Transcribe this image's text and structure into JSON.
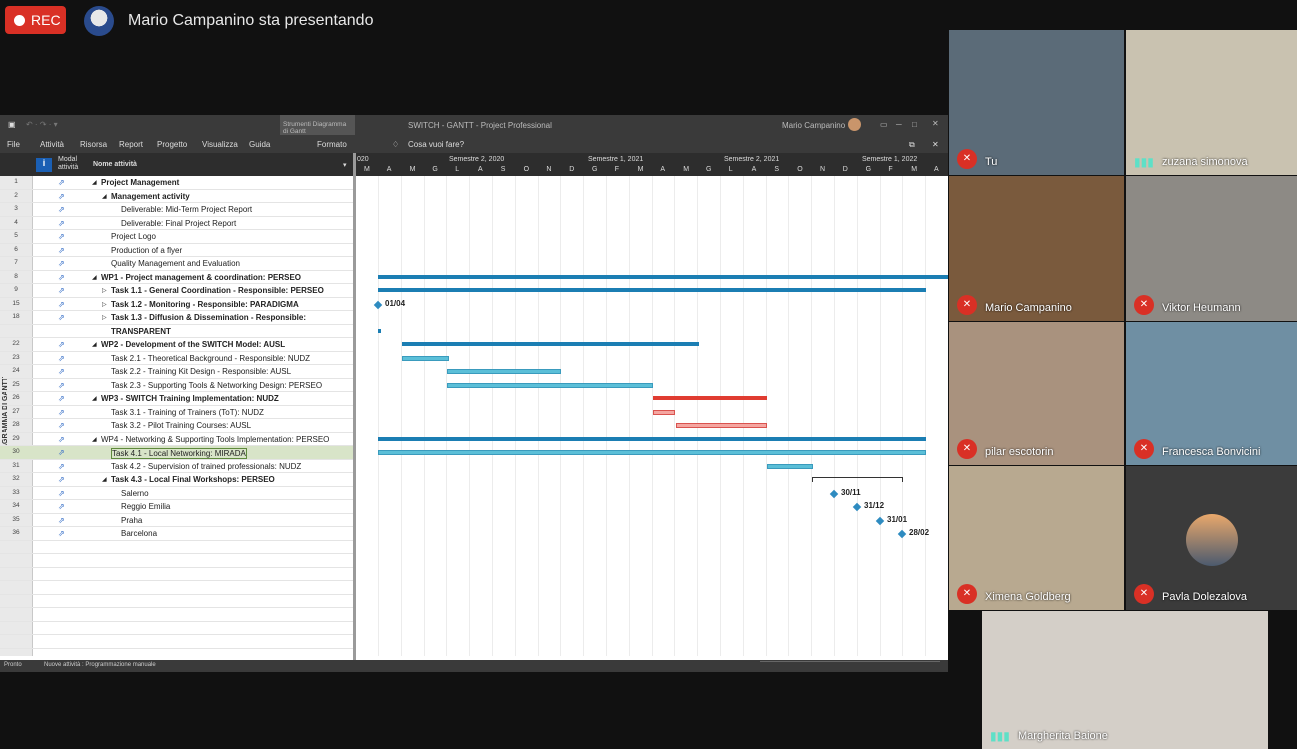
{
  "meeting": {
    "rec_label": "REC",
    "presenter_label": "Mario Campanino sta presentando"
  },
  "project_window": {
    "title_tools": "Strumenti Diagramma di Gantt",
    "title": "SWITCH - GANTT - Project Professional",
    "user": "Mario Campanino",
    "menu": [
      "File",
      "Attività",
      "Risorsa",
      "Report",
      "Progetto",
      "Visualizza",
      "Guida",
      "Formato"
    ],
    "tell_me": "Cosa vuoi fare?",
    "grid_headers": {
      "mode": "Modal attività",
      "name": "Nome attività"
    },
    "side_tab": "DIAGRAMMA DI GANTT",
    "timeline": {
      "semesters": [
        "Semestre 2, 2020",
        "Semestre 1, 2021",
        "Semestre 2, 2021",
        "Semestre 1, 2022"
      ],
      "year_stub": "020",
      "months": [
        "M",
        "A",
        "M",
        "G",
        "L",
        "A",
        "S",
        "O",
        "N",
        "D",
        "G",
        "F",
        "M",
        "A",
        "M",
        "G",
        "L",
        "A",
        "S",
        "O",
        "N",
        "D",
        "G",
        "F",
        "M",
        "A"
      ]
    },
    "rows": [
      {
        "id": "1",
        "name": "Project Management",
        "indent": 0,
        "bold": true,
        "prefix": "◢"
      },
      {
        "id": "2",
        "name": "Management activity",
        "indent": 1,
        "bold": true,
        "prefix": "◢"
      },
      {
        "id": "3",
        "name": "Deliverable: Mid-Term Project Report",
        "indent": 2,
        "bold": false,
        "prefix": ""
      },
      {
        "id": "4",
        "name": "Deliverable: Final Project Report",
        "indent": 2,
        "bold": false,
        "prefix": ""
      },
      {
        "id": "5",
        "name": "Project Logo",
        "indent": 1,
        "bold": false,
        "prefix": ""
      },
      {
        "id": "6",
        "name": "Production of a flyer",
        "indent": 1,
        "bold": false,
        "prefix": ""
      },
      {
        "id": "7",
        "name": "Quality Management and Evaluation",
        "indent": 1,
        "bold": false,
        "prefix": ""
      },
      {
        "id": "8",
        "name": "WP1 - Project management & coordination: PERSEO",
        "indent": 0,
        "bold": true,
        "prefix": "◢"
      },
      {
        "id": "9",
        "name": "Task 1.1 - General Coordination - Responsible: PERSEO",
        "indent": 1,
        "bold": true,
        "prefix": "▷"
      },
      {
        "id": "15",
        "name": "Task 1.2 - Monitoring - Responsible: PARADIGMA",
        "indent": 1,
        "bold": true,
        "prefix": "▷"
      },
      {
        "id": "18",
        "name": "Task 1.3 - Diffusion & Dissemination - Responsible:",
        "indent": 1,
        "bold": true,
        "prefix": "▷"
      },
      {
        "id": "",
        "name": "TRANSPARENT",
        "indent": 1,
        "bold": true,
        "prefix": ""
      },
      {
        "id": "22",
        "name": "WP2 - Development of the SWITCH Model: AUSL",
        "indent": 0,
        "bold": true,
        "prefix": "◢"
      },
      {
        "id": "23",
        "name": "Task 2.1 - Theoretical Background - Responsible: NUDZ",
        "indent": 1,
        "bold": false,
        "prefix": ""
      },
      {
        "id": "24",
        "name": "Task 2.2 - Training Kit Design - Responsible: AUSL",
        "indent": 1,
        "bold": false,
        "prefix": ""
      },
      {
        "id": "25",
        "name": "Task 2.3 - Supporting Tools & Networking Design: PERSEO",
        "indent": 1,
        "bold": false,
        "prefix": ""
      },
      {
        "id": "26",
        "name": "WP3 - SWITCH Training Implementation: NUDZ",
        "indent": 0,
        "bold": true,
        "prefix": "◢"
      },
      {
        "id": "27",
        "name": "Task 3.1 - Training of Trainers (ToT): NUDZ",
        "indent": 1,
        "bold": false,
        "prefix": ""
      },
      {
        "id": "28",
        "name": "Task 3.2 - Pilot Training Courses: AUSL",
        "indent": 1,
        "bold": false,
        "prefix": ""
      },
      {
        "id": "29",
        "name": "WP4 - Networking & Supporting Tools Implementation: PERSEO",
        "indent": 0,
        "bold": false,
        "prefix": "◢"
      },
      {
        "id": "30",
        "name": "Task 4.1 - Local Networking: MIRADA",
        "indent": 1,
        "bold": false,
        "prefix": "",
        "selected": true
      },
      {
        "id": "31",
        "name": "Task 4.2 - Supervision of trained professionals: NUDZ",
        "indent": 1,
        "bold": false,
        "prefix": ""
      },
      {
        "id": "32",
        "name": "Task 4.3 - Local Final Workshops: PERSEO",
        "indent": 1,
        "bold": true,
        "prefix": "◢"
      },
      {
        "id": "33",
        "name": "Salerno",
        "indent": 2,
        "bold": false,
        "prefix": ""
      },
      {
        "id": "34",
        "name": "Reggio Emilia",
        "indent": 2,
        "bold": false,
        "prefix": ""
      },
      {
        "id": "35",
        "name": "Praha",
        "indent": 2,
        "bold": false,
        "prefix": ""
      },
      {
        "id": "36",
        "name": "Barcelona",
        "indent": 2,
        "bold": false,
        "prefix": ""
      }
    ],
    "milestones": [
      "01/04",
      "30/11",
      "31/12",
      "31/01",
      "28/02"
    ],
    "status": [
      "Pronto",
      "Nuove attività : Programmazione manuale"
    ]
  },
  "participants": [
    {
      "name": "Tu",
      "state": "muted"
    },
    {
      "name": "zuzana simonova",
      "state": "talking"
    },
    {
      "name": "Mario Campanino",
      "state": "muted"
    },
    {
      "name": "Viktor Heumann",
      "state": "muted"
    },
    {
      "name": "pilar escotorin",
      "state": "muted"
    },
    {
      "name": "Francesca Bonvicini",
      "state": "muted"
    },
    {
      "name": "Ximena Goldberg",
      "state": "muted"
    },
    {
      "name": "Pavla Dolezalova",
      "state": "muted"
    },
    {
      "name": "Margherita Baione",
      "state": "talking"
    }
  ],
  "colors": {
    "rec": "#d93025",
    "summary_bar": "#1b7eb3",
    "task_bar": "#5bbfd8",
    "critical": "#e03c31"
  }
}
